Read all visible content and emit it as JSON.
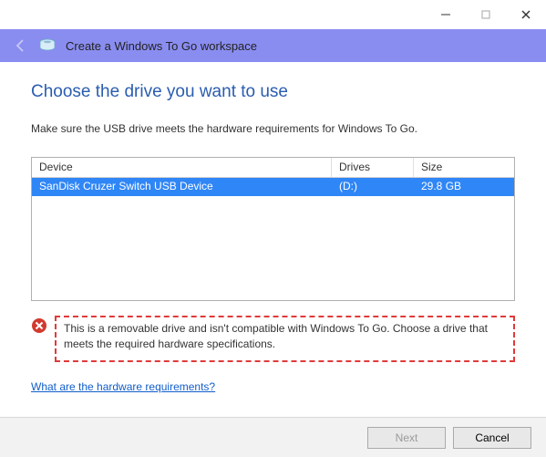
{
  "window": {
    "title": "Create a Windows To Go workspace"
  },
  "page": {
    "heading": "Choose the drive you want to use",
    "instruction": "Make sure the USB drive meets the hardware requirements for Windows To Go."
  },
  "table": {
    "headers": {
      "device": "Device",
      "drives": "Drives",
      "size": "Size"
    },
    "rows": [
      {
        "device": "SanDisk Cruzer Switch USB Device",
        "drives": "(D:)",
        "size": "29.8 GB",
        "selected": true
      }
    ]
  },
  "warning": {
    "text": "This is a removable drive and isn't compatible with Windows To Go. Choose a drive that meets the required hardware specifications."
  },
  "help_link": "What are the hardware requirements?",
  "buttons": {
    "next": "Next",
    "cancel": "Cancel"
  }
}
